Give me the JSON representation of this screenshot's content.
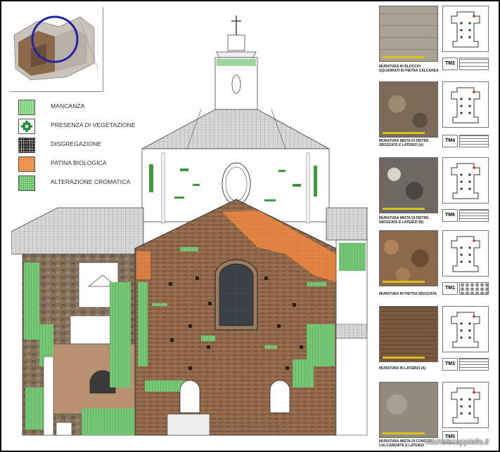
{
  "legend": [
    {
      "label": "MANCANZA",
      "icon": "green-hatch-swatch",
      "color": "#7fd37f"
    },
    {
      "label": "PRESENZA DI VEGETAZIONE",
      "icon": "vegetation-star-icon",
      "color": "#1f8a3a"
    },
    {
      "label": "DISGREGAZIONE",
      "icon": "speckle-swatch",
      "color": "#333333"
    },
    {
      "label": "PATINA BIOLOGICA",
      "icon": "orange-swatch",
      "color": "#e8833a"
    },
    {
      "label": "ALTERAZIONE CROMATICA",
      "icon": "green-grid-swatch",
      "color": "#67c467"
    }
  ],
  "panels": [
    {
      "code": "TM2",
      "caption": "MURATURA IN BLOCCHI SQUADRATI DI PIETRA CALCAREA",
      "photo_color": "#a09a8c"
    },
    {
      "code": "TM4",
      "caption": "MURATURA MISTA DI PIETRE SBOZZATE E LATERIZI (A)",
      "photo_color": "#7b6b58"
    },
    {
      "code": "TM6",
      "caption": "MURATURA MISTA DI PIETRE SBOZZATE E LATERIZI (B)",
      "photo_color": "#6e6862"
    },
    {
      "code": "TM1",
      "caption": "MURATURA IN PIETRA SBOZZATA",
      "photo_color": "#8a6a4a"
    },
    {
      "code": "TM3",
      "caption": "MURATURA IN LATERIZI (A)",
      "photo_color": "#7a5a3e"
    },
    {
      "code": "TM5",
      "caption": "MURATURA MISTA DI CONCI DI CALCARENITE E LATERIZI",
      "photo_color": "#938a7e"
    }
  ],
  "watermark": "michelecappiello.it"
}
